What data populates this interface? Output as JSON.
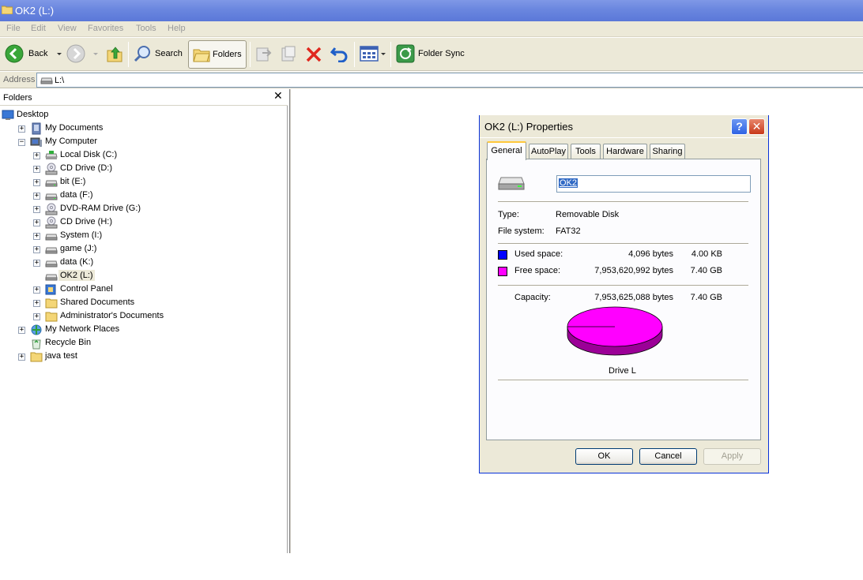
{
  "window": {
    "title": "OK2 (L:)"
  },
  "menu": [
    "File",
    "Edit",
    "View",
    "Favorites",
    "Tools",
    "Help"
  ],
  "toolbar": {
    "back_label": "Back",
    "search_label": "Search",
    "folders_label": "Folders",
    "folder_sync_label": "Folder Sync"
  },
  "address": {
    "label": "Address",
    "value": "L:\\"
  },
  "folders_pane": {
    "title": "Folders",
    "close": "✕",
    "tree": [
      {
        "label": "Desktop",
        "icon": "desktop-icon",
        "expander": ""
      },
      {
        "label": "My Documents",
        "icon": "my-documents-icon",
        "expander": "+"
      },
      {
        "label": "My Computer",
        "icon": "my-computer-icon",
        "expander": "−"
      },
      {
        "label": "Local Disk (C:)",
        "icon": "local-disk-icon",
        "expander": "+"
      },
      {
        "label": "CD Drive (D:)",
        "icon": "cd-drive-icon",
        "expander": "+"
      },
      {
        "label": "bit (E:)",
        "icon": "drive-icon",
        "expander": "+"
      },
      {
        "label": "data (F:)",
        "icon": "drive-icon",
        "expander": "+"
      },
      {
        "label": "DVD-RAM Drive (G:)",
        "icon": "dvd-drive-icon",
        "expander": "+"
      },
      {
        "label": "CD Drive (H:)",
        "icon": "cd-drive-icon",
        "expander": "+"
      },
      {
        "label": "System (I:)",
        "icon": "removable-drive-icon",
        "expander": "+"
      },
      {
        "label": "game (J:)",
        "icon": "removable-drive-icon",
        "expander": "+"
      },
      {
        "label": "data (K:)",
        "icon": "removable-drive-icon",
        "expander": "+"
      },
      {
        "label": "OK2 (L:)",
        "icon": "removable-drive-icon",
        "expander": "",
        "selected": true
      },
      {
        "label": "Control Panel",
        "icon": "control-panel-icon",
        "expander": "+"
      },
      {
        "label": "Shared Documents",
        "icon": "folder-icon",
        "expander": "+"
      },
      {
        "label": "Administrator's Documents",
        "icon": "folder-icon",
        "expander": "+"
      },
      {
        "label": "My Network Places",
        "icon": "network-places-icon",
        "expander": "+"
      },
      {
        "label": "Recycle Bin",
        "icon": "recycle-bin-icon",
        "expander": ""
      },
      {
        "label": "java test",
        "icon": "folder-icon",
        "expander": "+"
      }
    ]
  },
  "dialog": {
    "title": "OK2 (L:) Properties",
    "help": "?",
    "close": "✕",
    "tabs": [
      "General",
      "AutoPlay",
      "Tools",
      "Hardware",
      "Sharing"
    ],
    "active_tab": "General",
    "name_value": "OK2",
    "type_label": "Type:",
    "type_value": "Removable Disk",
    "fs_label": "File system:",
    "fs_value": "FAT32",
    "used_label": "Used space:",
    "used_bytes": "4,096 bytes",
    "used_size": "4.00 KB",
    "used_color": "#0000ff",
    "free_label": "Free space:",
    "free_bytes": "7,953,620,992 bytes",
    "free_size": "7.40 GB",
    "free_color": "#ff00ff",
    "capacity_label": "Capacity:",
    "capacity_bytes": "7,953,625,088 bytes",
    "capacity_size": "7.40 GB",
    "drive_label": "Drive L",
    "ok_label": "OK",
    "cancel_label": "Cancel",
    "apply_label": "Apply"
  },
  "chart_data": {
    "type": "pie",
    "categories": [
      "Used space",
      "Free space"
    ],
    "values": [
      4096,
      7953620992
    ],
    "colors": [
      "#0000ff",
      "#ff00ff"
    ]
  }
}
